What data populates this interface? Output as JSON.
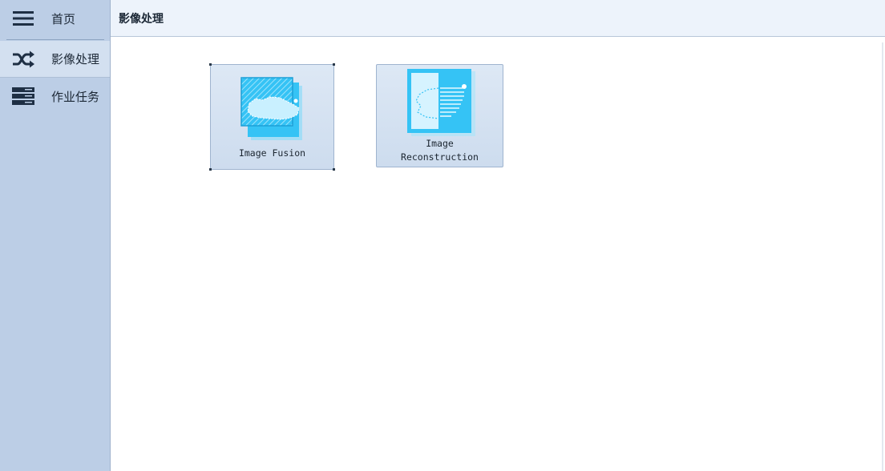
{
  "sidebar": {
    "items": [
      {
        "label": "首页",
        "icon": "menu-icon"
      },
      {
        "label": "影像处理",
        "icon": "shuffle-icon",
        "active": true
      },
      {
        "label": "作业任务",
        "icon": "task-list-icon"
      }
    ]
  },
  "header": {
    "title": "影像处理"
  },
  "tiles": [
    {
      "line1": "Image Fusion",
      "line2": "",
      "icon": "image-fusion-icon"
    },
    {
      "line1": "Image",
      "line2": "Reconstruction",
      "icon": "image-reconstruction-icon"
    }
  ],
  "colors": {
    "sidebar_bg": "#bccee6",
    "accent": "#35c3f5",
    "tile_bg": "#d6e3f2"
  }
}
